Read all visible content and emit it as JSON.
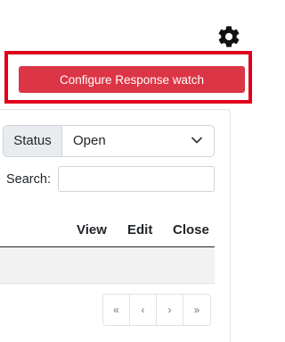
{
  "header": {
    "settings_icon": "gear-icon"
  },
  "configure": {
    "button_label": "Configure Response watch",
    "highlight_color": "#e0001b",
    "button_color": "#dc3545"
  },
  "filters": {
    "status_label": "Status",
    "status_value": "Open",
    "search_label": "Search:",
    "search_value": ""
  },
  "table": {
    "columns": [
      "View",
      "Edit",
      "Close"
    ]
  },
  "pagination": {
    "first": "«",
    "prev": "‹",
    "next": "›",
    "last": "»"
  }
}
